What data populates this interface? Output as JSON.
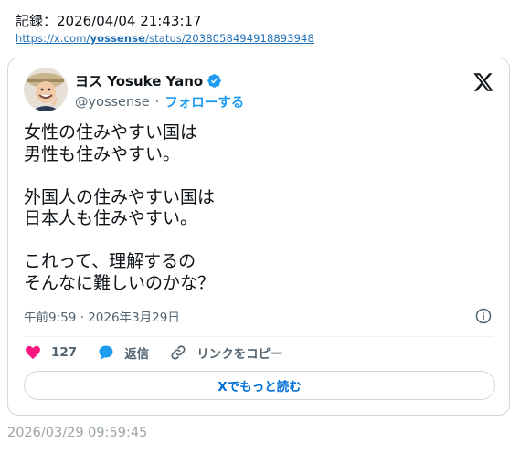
{
  "record": {
    "label": "記録：2026/04/04 21:43:17",
    "url_prefix": "https://x.com/",
    "url_user": "yossense",
    "url_suffix": "/status/2038058494918893948"
  },
  "tweet": {
    "display_name": "ヨス Yosuke Yano",
    "handle": "@yossense",
    "separator": "·",
    "follow_label": "フォローする",
    "text_lines": [
      "女性の住みやすい国は",
      "男性も住みやすい。",
      "",
      "外国人の住みやすい国は",
      "日本人も住みやすい。",
      "",
      "これって、理解するの",
      "そんなに難しいのかな？"
    ],
    "timestamp": "午前9:59 · 2026年3月29日",
    "like_count": "127",
    "reply_label": "返信",
    "copy_link_label": "リンクをコピー",
    "read_more_label": "Xでもっと読む"
  },
  "archive_time": "2026/03/29 09:59:45",
  "colors": {
    "accent": "#1d9bf0",
    "like": "#f91880",
    "link": "#1d6fb8",
    "muted": "#536471"
  },
  "icons": [
    "avatar",
    "verified-badge-icon",
    "x-logo-icon",
    "info-icon",
    "heart-icon",
    "reply-bubble-icon",
    "link-icon"
  ]
}
